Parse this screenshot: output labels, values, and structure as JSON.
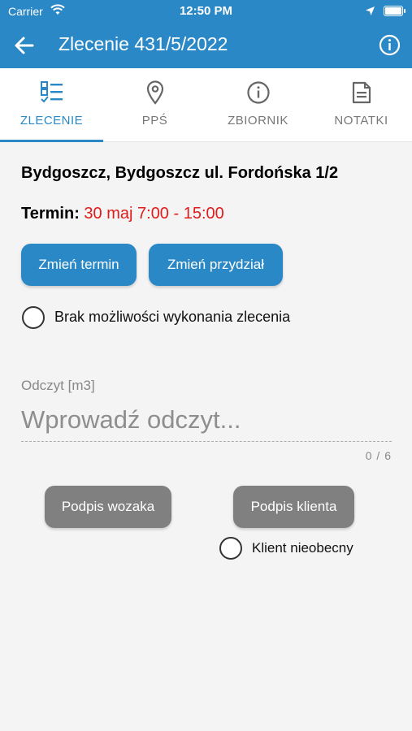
{
  "status_bar": {
    "carrier": "Carrier",
    "time": "12:50 PM"
  },
  "app_bar": {
    "title": "Zlecenie 431/5/2022"
  },
  "tabs": [
    {
      "label": "ZLECENIE",
      "icon": "checklist-icon",
      "active": true
    },
    {
      "label": "PPŚ",
      "icon": "location-pin-icon",
      "active": false
    },
    {
      "label": "ZBIORNIK",
      "icon": "info-icon",
      "active": false
    },
    {
      "label": "NOTATKI",
      "icon": "document-icon",
      "active": false
    }
  ],
  "order": {
    "address": "Bydgoszcz, Bydgoszcz ul. Fordońska 1/2",
    "termin_label": "Termin:",
    "termin_value": "30 maj 7:00 - 15:00"
  },
  "actions": {
    "change_date": "Zmień termin",
    "change_assignment": "Zmień przydział"
  },
  "cannot_execute": {
    "label": "Brak możliwości wykonania zlecenia",
    "checked": false
  },
  "reading": {
    "label": "Odczyt [m3]",
    "placeholder": "Wprowadź odczyt...",
    "value": "",
    "counter": "0 / 6"
  },
  "signatures": {
    "driver": "Podpis wozaka",
    "client": "Podpis klienta"
  },
  "client_absent": {
    "label": "Klient nieobecny",
    "checked": false
  },
  "colors": {
    "primary": "#2a88c6",
    "termin": "#e01b1b",
    "gray_button": "#808080"
  }
}
